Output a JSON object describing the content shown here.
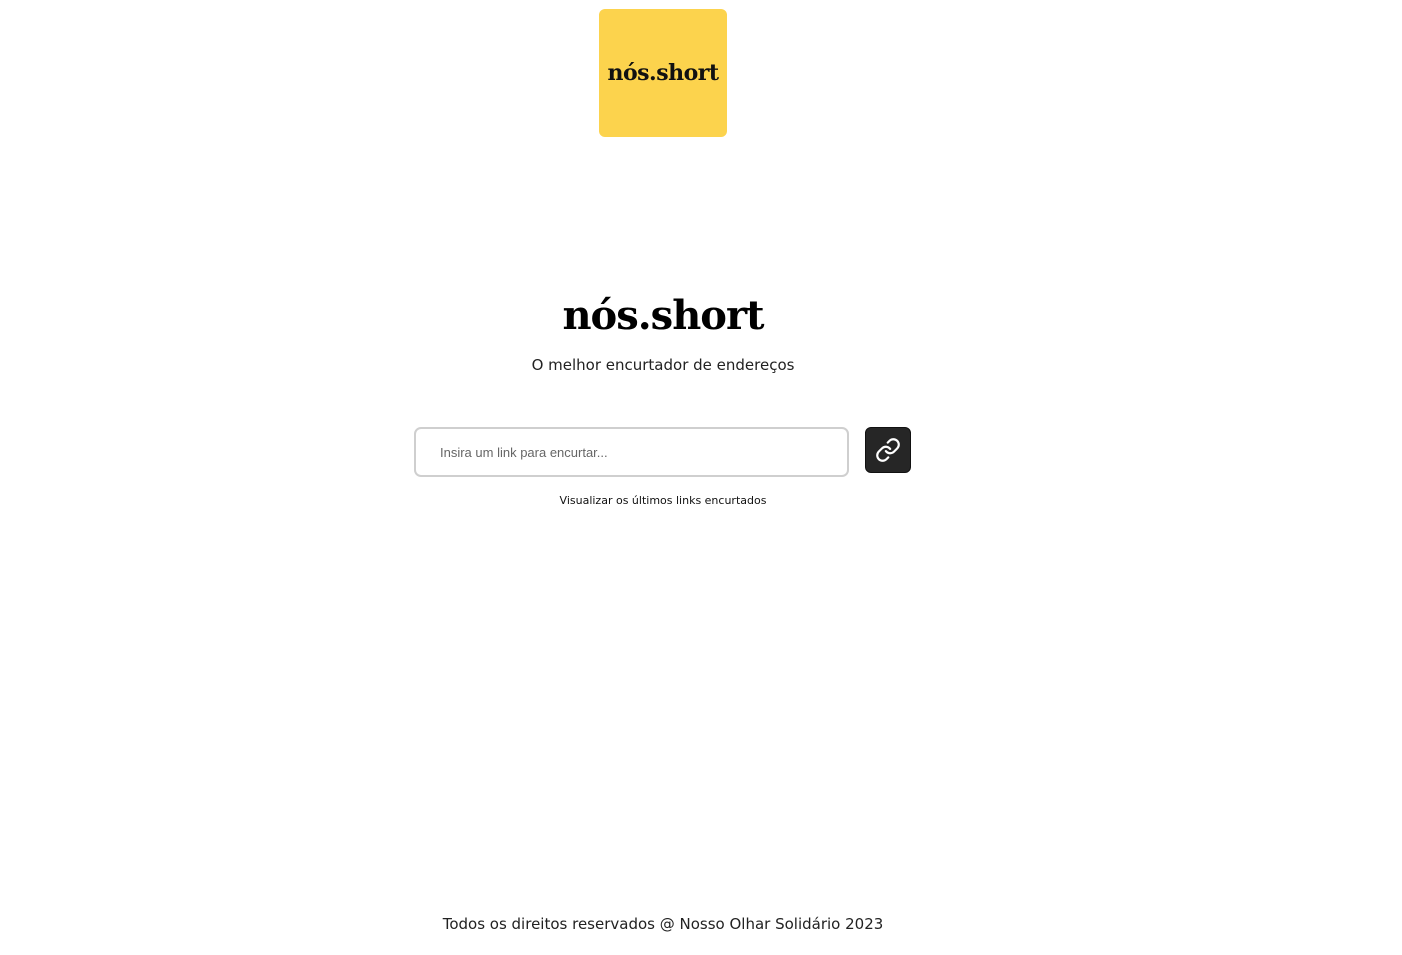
{
  "logo": {
    "text": "nós.short",
    "background_color": "#fcd34d"
  },
  "hero": {
    "title": "nós.short",
    "subtitle": "O melhor encurtador de endereços"
  },
  "shortener": {
    "placeholder": "Insira um link para encurtar...",
    "value": "",
    "button_icon": "link-icon",
    "button_color": "#262626"
  },
  "recent_links": {
    "label": "Visualizar os últimos links encurtados"
  },
  "footer": {
    "text": "Todos os direitos reservados @ Nosso Olhar Solidário 2023"
  }
}
